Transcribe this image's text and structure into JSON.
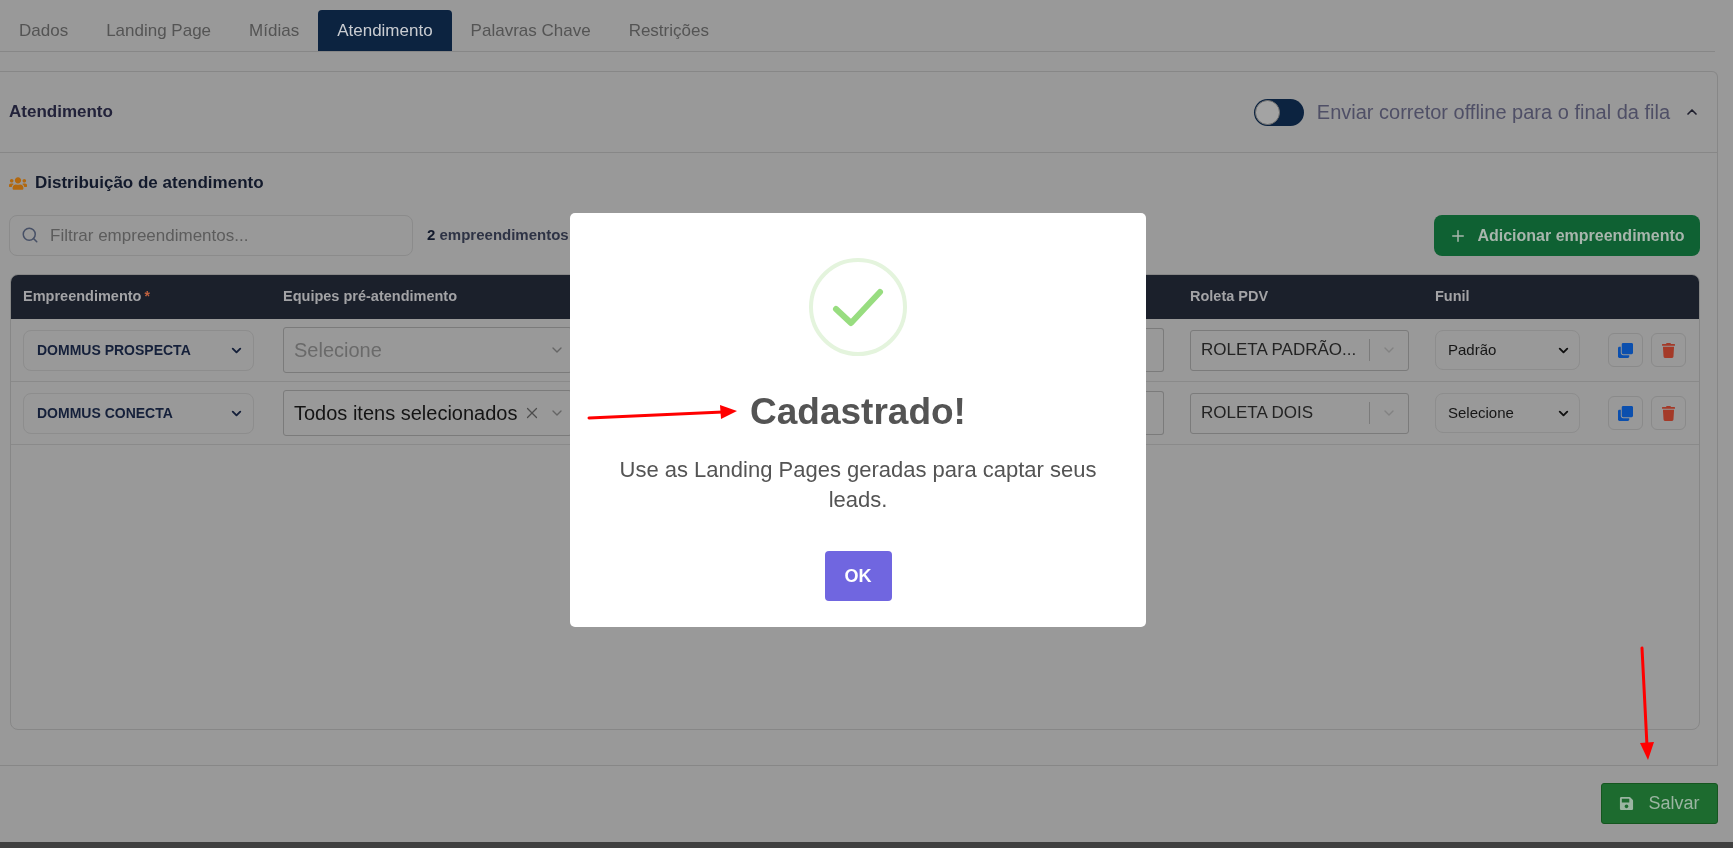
{
  "tabs": [
    {
      "label": "Dados",
      "selected": false
    },
    {
      "label": "Landing Page",
      "selected": false
    },
    {
      "label": "Mídias",
      "selected": false
    },
    {
      "label": "Atendimento",
      "selected": true
    },
    {
      "label": "Palavras Chave",
      "selected": false
    },
    {
      "label": "Restrições",
      "selected": false
    }
  ],
  "panel": {
    "title": "Atendimento",
    "expanded": true,
    "toggle": {
      "label": "Enviar corretor offline para o final da fila",
      "on": false
    }
  },
  "distribution": {
    "title": "Distribuição de atendimento",
    "search": {
      "placeholder": "Filtrar empreendimentos..."
    },
    "count": "**2** empreendimentos",
    "add_button": "Adicionar empreendimento"
  },
  "table": {
    "columns": [
      {
        "label": "Empreendimento",
        "mark": "*"
      },
      {
        "label": "Equipes pré-atendimento"
      },
      {
        "label": "Roleta PDV"
      },
      {
        "label": "Funil"
      }
    ],
    "rows": [
      {
        "empreendimento": "DOMMUS PROSPECTA",
        "equipes": {
          "placeholder": "Selecione"
        },
        "roleta": "ROLETA PADRÃO...",
        "funil": "Padrão"
      },
      {
        "empreendimento": "DOMMUS CONECTA",
        "equipes": {
          "value": "Todos itens selecionados"
        },
        "roleta": "ROLETA DOIS",
        "funil": "Selecione"
      }
    ]
  },
  "footer": {
    "save_button": "Salvar"
  },
  "dialog": {
    "title": "Cadastrado!",
    "message": "Use as Landing Pages geradas para captar seus leads.",
    "ok_button": "OK"
  }
}
